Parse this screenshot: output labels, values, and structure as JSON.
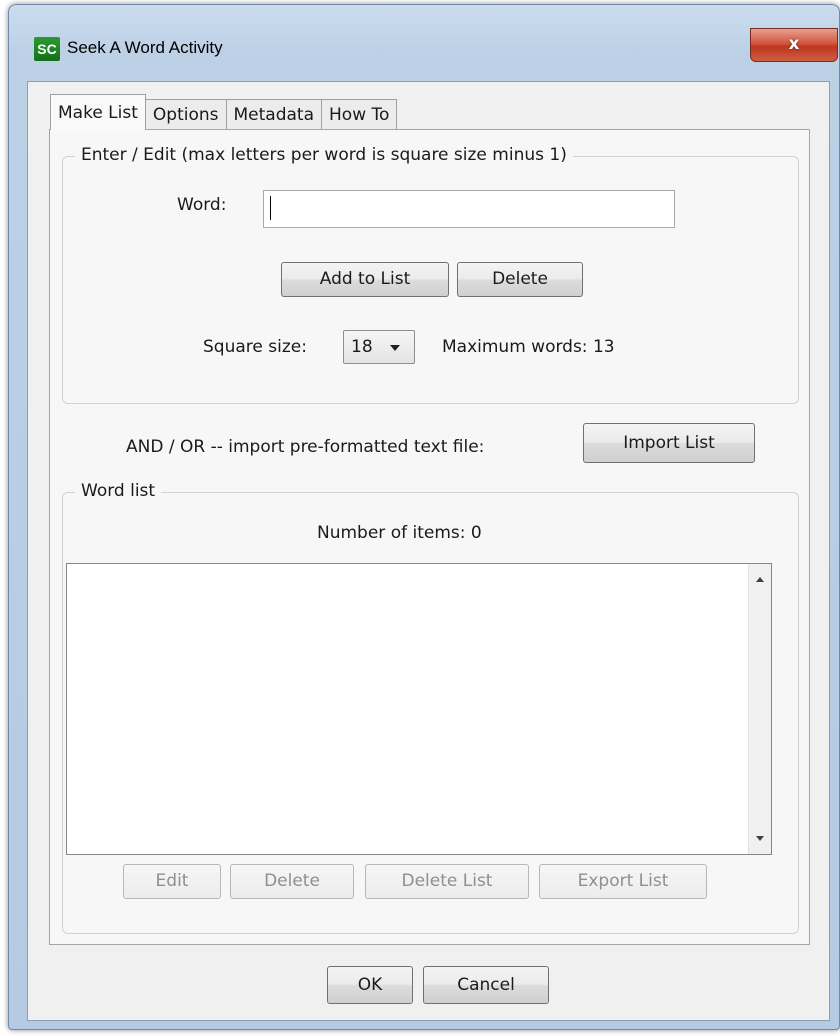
{
  "window": {
    "title": "Seek A Word Activity",
    "icon_text": "SC",
    "close_glyph": "x"
  },
  "tabs": [
    {
      "label": "Make List",
      "active": true
    },
    {
      "label": "Options"
    },
    {
      "label": "Metadata"
    },
    {
      "label": "How To"
    }
  ],
  "enter_group": {
    "legend": "Enter / Edit (max letters per word is square size minus 1)",
    "word_label": "Word:",
    "word_value": "",
    "add_button": "Add to List",
    "delete_button": "Delete",
    "square_size_label": "Square size:",
    "square_size_value": "18",
    "max_words_text": "Maximum words: 13"
  },
  "import": {
    "label": "AND / OR -- import pre-formatted text file:",
    "button": "Import List"
  },
  "word_list_group": {
    "legend": "Word list",
    "count_text": "Number of items: 0",
    "items": [],
    "buttons": {
      "edit": "Edit",
      "delete": "Delete",
      "delete_list": "Delete List",
      "export_list": "Export List"
    }
  },
  "footer": {
    "ok": "OK",
    "cancel": "Cancel"
  },
  "colors": {
    "frame": "#bcd0e6",
    "close_button": "#c9432b",
    "icon_green": "#1f8a26"
  },
  "icons": [
    "app-logo-icon",
    "close-icon",
    "chevron-down-icon",
    "scroll-up-icon",
    "scroll-down-icon"
  ]
}
